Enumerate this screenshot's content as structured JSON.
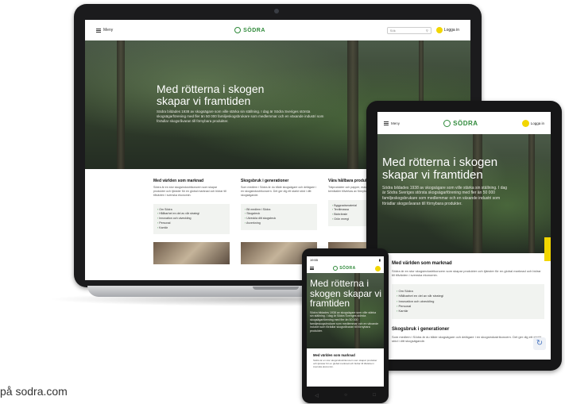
{
  "caption": "på sodra.com",
  "colors": {
    "brand_green": "#2f8a3a",
    "accent_yellow": "#f2d600",
    "hero_dark": "#35432f"
  },
  "site": {
    "menu_label": "Meny",
    "logo_text": "SÖDRA",
    "login_label": "Logga in",
    "search_placeholder": "Sök",
    "hero_title": "Med rötterna i skogen skapar vi framtiden",
    "hero_text": "Södra bildades 1938 av skogsägare som ville stärka sin ställning. I dag är Södra Sveriges största skogsägarförening med fler än 50 000 familjeskogsbrukare som medlemmar och en växande industri som förädlar skogsråvaran till förnybara produkter.",
    "columns": [
      {
        "title": "Med världen som marknad",
        "text": "Södra är en stor skogsindustrikoncern som skapar produkter och tjänster för en global marknad och bidrar till tillväxten i svenska ekonomin.",
        "links": [
          "Om Södra",
          "Hållbarhet en del av vår strategi",
          "Innovation och utveckling",
          "Personal",
          "Karriär"
        ]
      },
      {
        "title": "Skogsbruk i generationer",
        "text": "Som medlem i Södra är du både skogsägare och delägare i en skogsindustrikoncern. Det ger dig ett starkt stöd i ditt skogsägande.",
        "links": [
          "Bli medlem i Södra",
          "Skogsbruk",
          "Utveckla ditt skogsbruk",
          "Avverkning"
        ]
      },
      {
        "title": "Våra hållbara produkter",
        "text": "Träprodukter och papper, massa, biobränsle och gröna kemikalier tillverkas av förnybar råvara från skogen.",
        "links": [
          "Byggnadsmaterial",
          "Textilmassa",
          "Biobränsle",
          "Grön energi"
        ]
      }
    ]
  },
  "phone_status": {
    "time": "19:55",
    "battery_icon": "battery-icon"
  },
  "tablet_extra": {
    "recaptcha_icon": "recaptcha-icon"
  }
}
